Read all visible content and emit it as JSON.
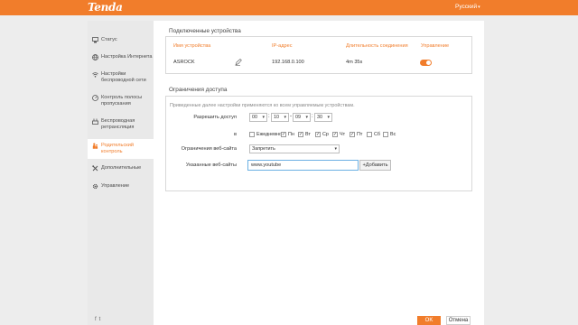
{
  "brand": {
    "logo": "Tenda",
    "accent": "#f17d2b"
  },
  "header": {
    "language": "Русский"
  },
  "sidebar": {
    "items": [
      {
        "label": "Статус",
        "icon": "status-icon"
      },
      {
        "label": "Настройка Интернета",
        "icon": "globe-icon"
      },
      {
        "label": "Настройки беспроводной сети",
        "icon": "wifi-icon"
      },
      {
        "label": "Контроль полосы пропускания",
        "icon": "bandwidth-icon"
      },
      {
        "label": "Беспроводная ретрансляция",
        "icon": "repeater-icon"
      },
      {
        "label": "Родительский контроль",
        "icon": "parental-control-icon",
        "active": true
      },
      {
        "label": "Дополнительные",
        "icon": "tools-icon"
      },
      {
        "label": "Управление",
        "icon": "settings-icon"
      }
    ],
    "social": {
      "facebook": "f",
      "twitter": "t"
    }
  },
  "devices": {
    "title": "Подключенные устройства",
    "columns": [
      "Имя устройства",
      "IP-адрес",
      "Длительность соединения",
      "Управление"
    ],
    "rows": [
      {
        "name": "ASROCK",
        "ip": "192.168.0.100",
        "duration": "4m 35s",
        "enabled": true
      }
    ]
  },
  "restrictions": {
    "title": "Ограничения доступа",
    "description": "Приведенные далее настройки применяются ко всем управляемым устройствам.",
    "allow_access_label": "Разрешить доступ",
    "time": {
      "from_hour": "00",
      "from_min": "10",
      "to_hour": "09",
      "to_min": "30"
    },
    "days_label": "в",
    "days": [
      {
        "label": "Ежедневно",
        "checked": false
      },
      {
        "label": "Пн",
        "checked": true
      },
      {
        "label": "Вт",
        "checked": true
      },
      {
        "label": "Ср",
        "checked": true
      },
      {
        "label": "Чт",
        "checked": true
      },
      {
        "label": "Пт",
        "checked": true
      },
      {
        "label": "Сб",
        "checked": false
      },
      {
        "label": "Вс",
        "checked": false
      }
    ],
    "website_limit_label": "Ограничения веб-сайта",
    "website_limit_value": "Запретить",
    "websites_label": "Указанные веб-сайты",
    "website_input_value": "www.youtube",
    "add_button": "+Добавить"
  },
  "footer": {
    "ok": "OK",
    "cancel": "Отмена"
  }
}
